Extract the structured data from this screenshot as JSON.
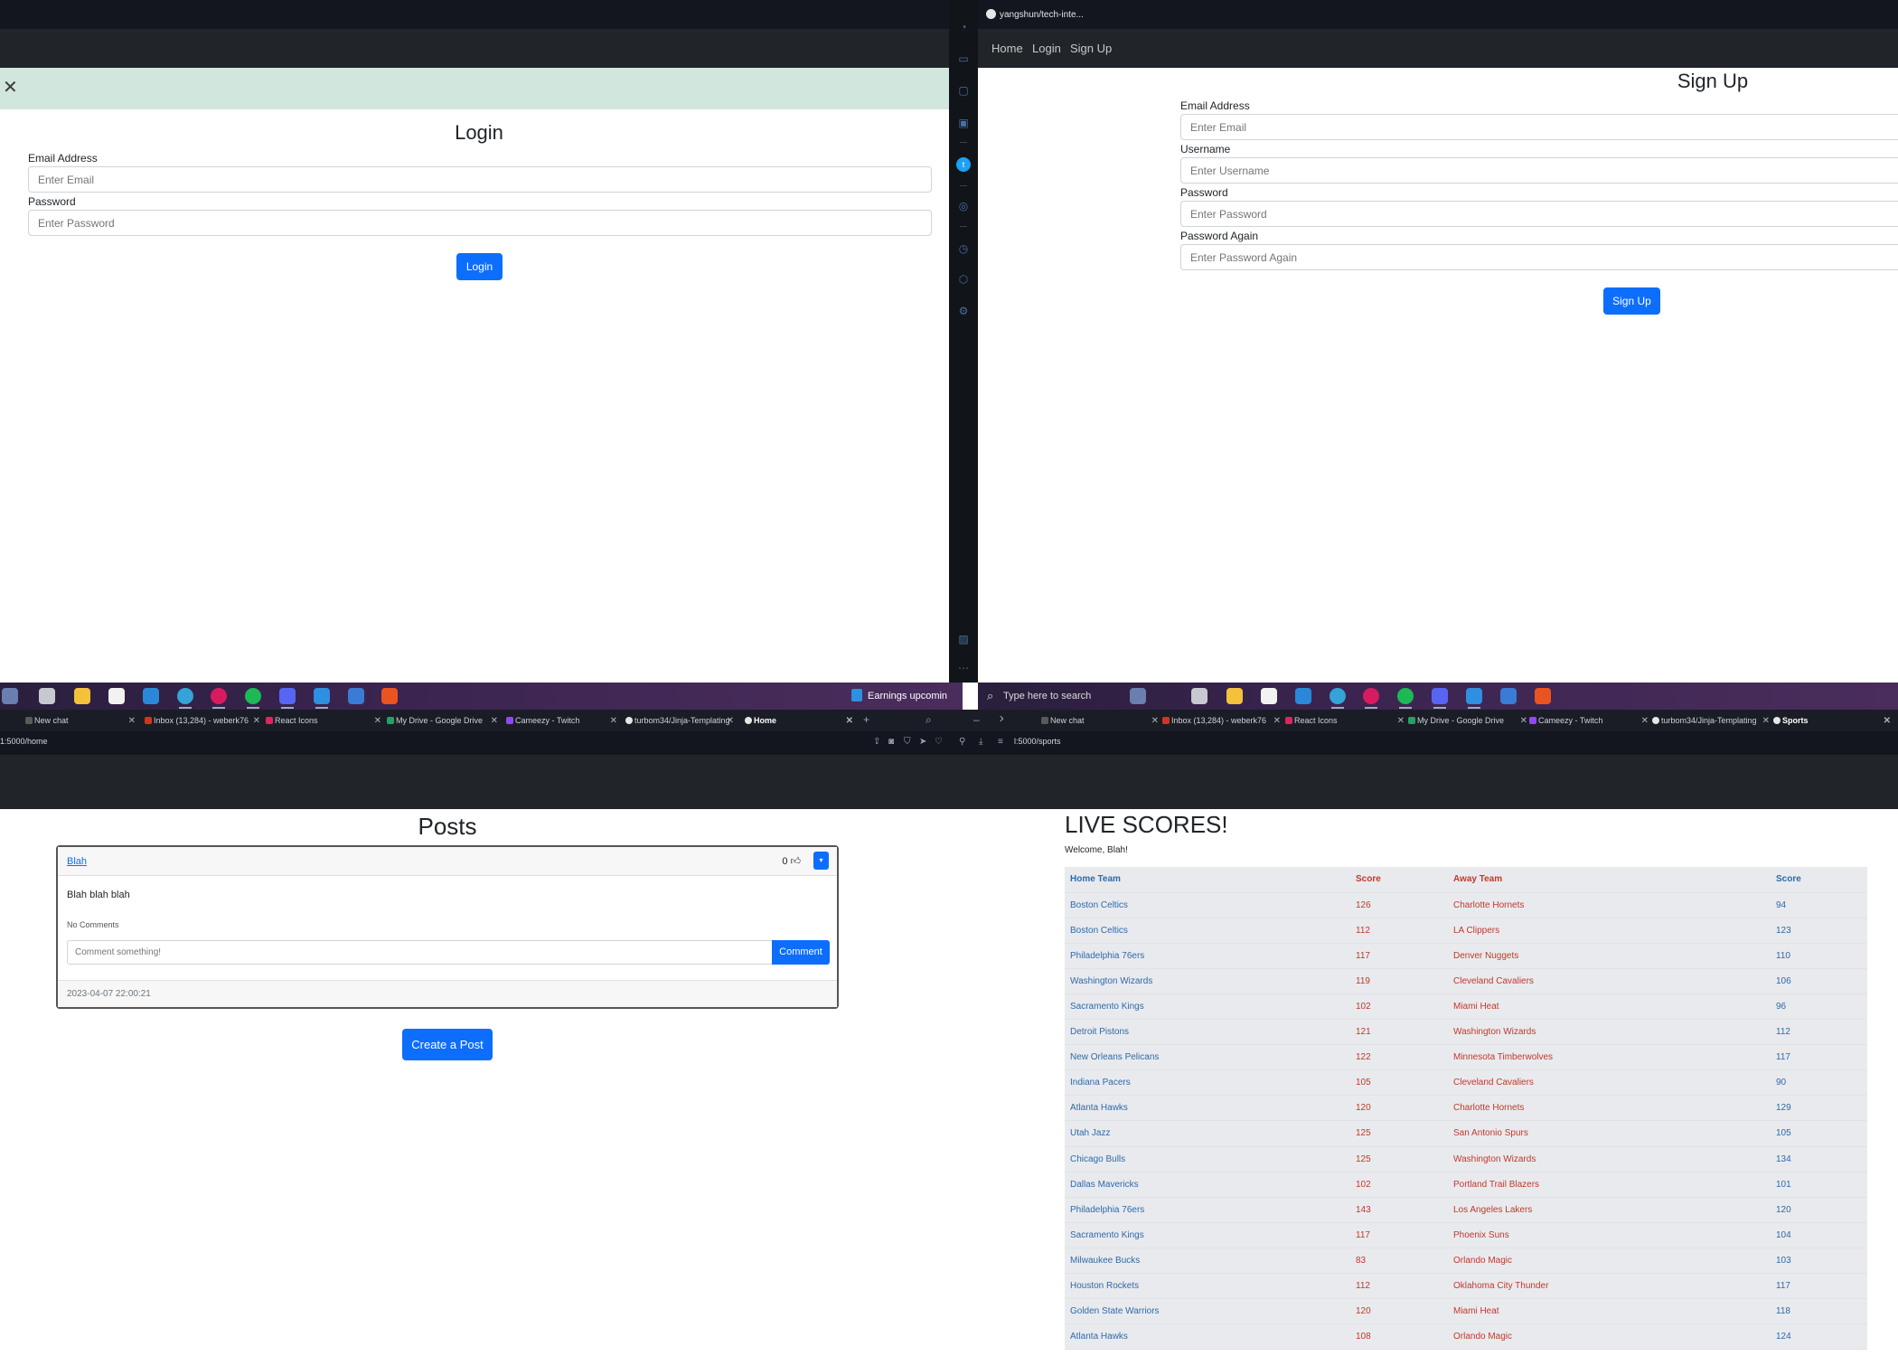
{
  "login": {
    "title": "Login",
    "email_label": "Email Address",
    "email_placeholder": "Enter Email",
    "password_label": "Password",
    "password_placeholder": "Enter Password",
    "button": "Login"
  },
  "signup": {
    "repo_label": "yangshun/tech-inte...",
    "nav": [
      "Home",
      "Login",
      "Sign Up"
    ],
    "title": "Sign Up",
    "email_label": "Email Address",
    "email_placeholder": "Enter Email",
    "username_label": "Username",
    "username_placeholder": "Enter Username",
    "password_label": "Password",
    "password_placeholder": "Enter Password",
    "password2_label": "Password Again",
    "password2_placeholder": "Enter Password Again",
    "button": "Sign Up"
  },
  "taskbar": {
    "earnings": "Earnings upcomin",
    "search_placeholder": "Type here to search"
  },
  "tabs_left": [
    {
      "label": "New chat",
      "color": "#5a5a5a"
    },
    {
      "label": "Inbox (13,284) - weberk76",
      "color": "#d93025"
    },
    {
      "label": "React Icons",
      "color": "#e0245e"
    },
    {
      "label": "My Drive - Google Drive",
      "color": "#1fa463"
    },
    {
      "label": "Cameezy - Twitch",
      "color": "#9146ff"
    },
    {
      "label": "turbom34/Jinja-Templating",
      "color": "#e6e6e6"
    },
    {
      "label": "Home",
      "color": "#e6e6e6"
    }
  ],
  "tabs_right": [
    {
      "label": "New chat",
      "color": "#5a5a5a"
    },
    {
      "label": "Inbox (13,284) - weberk76",
      "color": "#d93025"
    },
    {
      "label": "React Icons",
      "color": "#e0245e"
    },
    {
      "label": "My Drive - Google Drive",
      "color": "#1fa463"
    },
    {
      "label": "Cameezy - Twitch",
      "color": "#9146ff"
    },
    {
      "label": "turbom34/Jinja-Templating",
      "color": "#e6e6e6"
    },
    {
      "label": "Sports",
      "color": "#e6e6e6"
    }
  ],
  "url_left": "1:5000/home",
  "url_right": "l:5000/sports",
  "posts": {
    "title": "Posts",
    "author": "Blah",
    "likes": "0",
    "body": "Blah blah blah",
    "no_comments": "No Comments",
    "comment_placeholder": "Comment something!",
    "comment_button": "Comment",
    "date": "2023-04-07 22:00:21",
    "create_button": "Create a Post"
  },
  "scores": {
    "title": "LIVE SCORES!",
    "welcome": "Welcome, Blah!",
    "headers": [
      "Home Team",
      "Score",
      "Away Team",
      "Score"
    ],
    "rows": [
      [
        "Boston Celtics",
        "126",
        "Charlotte Hornets",
        "94"
      ],
      [
        "Boston Celtics",
        "112",
        "LA Clippers",
        "123"
      ],
      [
        "Philadelphia 76ers",
        "117",
        "Denver Nuggets",
        "110"
      ],
      [
        "Washington Wizards",
        "119",
        "Cleveland Cavaliers",
        "106"
      ],
      [
        "Sacramento Kings",
        "102",
        "Miami Heat",
        "96"
      ],
      [
        "Detroit Pistons",
        "121",
        "Washington Wizards",
        "112"
      ],
      [
        "New Orleans Pelicans",
        "122",
        "Minnesota Timberwolves",
        "117"
      ],
      [
        "Indiana Pacers",
        "105",
        "Cleveland Cavaliers",
        "90"
      ],
      [
        "Atlanta Hawks",
        "120",
        "Charlotte Hornets",
        "129"
      ],
      [
        "Utah Jazz",
        "125",
        "San Antonio Spurs",
        "105"
      ],
      [
        "Chicago Bulls",
        "125",
        "Washington Wizards",
        "134"
      ],
      [
        "Dallas Mavericks",
        "102",
        "Portland Trail Blazers",
        "101"
      ],
      [
        "Philadelphia 76ers",
        "143",
        "Los Angeles Lakers",
        "120"
      ],
      [
        "Sacramento Kings",
        "117",
        "Phoenix Suns",
        "104"
      ],
      [
        "Milwaukee Bucks",
        "83",
        "Orlando Magic",
        "103"
      ],
      [
        "Houston Rockets",
        "112",
        "Oklahoma City Thunder",
        "117"
      ],
      [
        "Golden State Warriors",
        "120",
        "Miami Heat",
        "118"
      ],
      [
        "Atlanta Hawks",
        "108",
        "Orlando Magic",
        "124"
      ]
    ]
  },
  "taskbar_icons": [
    {
      "name": "task-view-icon",
      "color": "#c8c8d0"
    },
    {
      "name": "file-explorer-icon",
      "color": "#f3c13a"
    },
    {
      "name": "store-icon",
      "color": "#f2f2f2"
    },
    {
      "name": "mail-icon",
      "color": "#2b88d8"
    },
    {
      "name": "edge-icon",
      "color": "#35a3d8"
    },
    {
      "name": "opera-icon",
      "color": "#d81b60"
    },
    {
      "name": "spotify-icon",
      "color": "#1db954"
    },
    {
      "name": "discord-icon",
      "color": "#5865f2"
    },
    {
      "name": "vscode-icon",
      "color": "#2f8fe0"
    },
    {
      "name": "play-app-icon",
      "color": "#3a7bd5"
    },
    {
      "name": "ubuntu-icon",
      "color": "#e95420"
    }
  ]
}
